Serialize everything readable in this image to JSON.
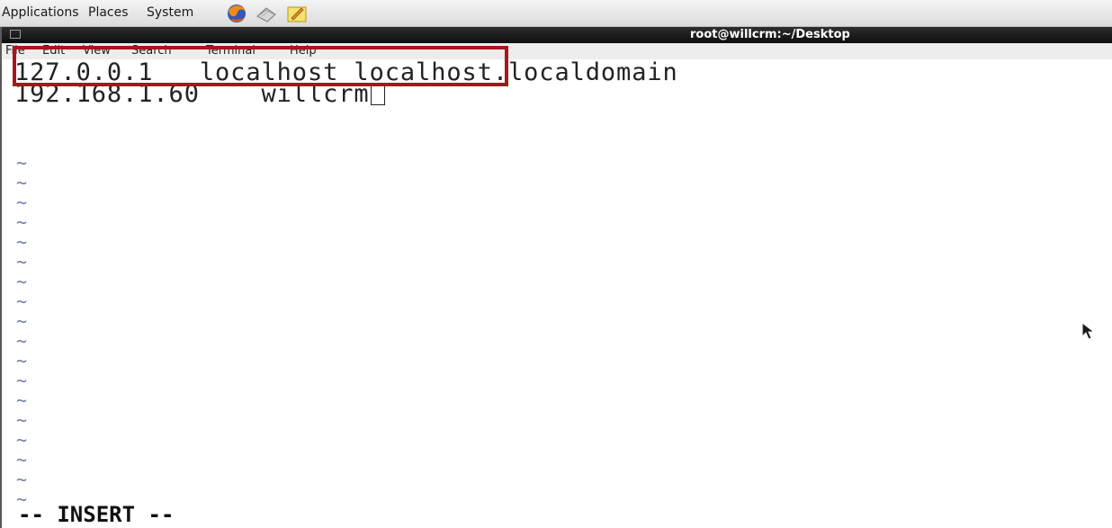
{
  "panel": {
    "menus": [
      "Applications",
      "Places",
      "System"
    ],
    "launchers": [
      "firefox-icon",
      "mail-icon",
      "notes-icon"
    ]
  },
  "window": {
    "title": "root@willcrm:~/Desktop",
    "menubar": [
      "File",
      "Edit",
      "View",
      "Search",
      "Terminal",
      "Help"
    ]
  },
  "editor": {
    "lines": [
      "127.0.0.1   localhost localhost.localdomain",
      "192.168.1.60    willcrm"
    ],
    "empty_marker": "~",
    "mode": "-- INSERT --"
  },
  "colors": {
    "highlight_box": "#a8161c",
    "tilde": "#7080a8",
    "titlebar": "#1a1a1a"
  }
}
